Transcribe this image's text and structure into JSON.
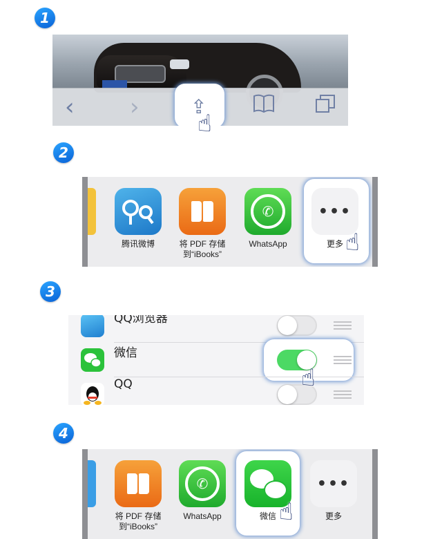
{
  "steps": [
    "1",
    "2",
    "3",
    "4"
  ],
  "step1": {
    "toolbar": {
      "back": "‹",
      "forward": "›",
      "share": "⇪",
      "bookmarks": "📖",
      "tabs": "⧉"
    }
  },
  "step2": {
    "apps": [
      {
        "label": "腾讯微博",
        "icon": "tencent-weibo-icon"
      },
      {
        "label": "将 PDF 存储\n到“iBooks”",
        "icon": "ibooks-icon"
      },
      {
        "label": "WhatsApp",
        "icon": "whatsapp-icon"
      },
      {
        "label": "更多",
        "icon": "more-icon"
      }
    ]
  },
  "step3": {
    "rows": [
      {
        "name": "QQ浏览器",
        "enabled": false,
        "icon": "qq-browser-icon"
      },
      {
        "name": "微信",
        "enabled": true,
        "icon": "wechat-icon"
      },
      {
        "name": "QQ",
        "enabled": false,
        "icon": "qq-icon"
      }
    ]
  },
  "step4": {
    "apps": [
      {
        "label": "将 PDF 存储\n到“iBooks”",
        "icon": "ibooks-icon"
      },
      {
        "label": "WhatsApp",
        "icon": "whatsapp-icon"
      },
      {
        "label": "微信",
        "icon": "wechat-icon"
      },
      {
        "label": "更多",
        "icon": "more-icon"
      }
    ]
  },
  "colors": {
    "badge": "#1a7fe8",
    "toggle_on": "#4cd964",
    "wechat": "#1fb733",
    "whatsapp": "#25c23a",
    "ibooks": "#f08a25"
  }
}
